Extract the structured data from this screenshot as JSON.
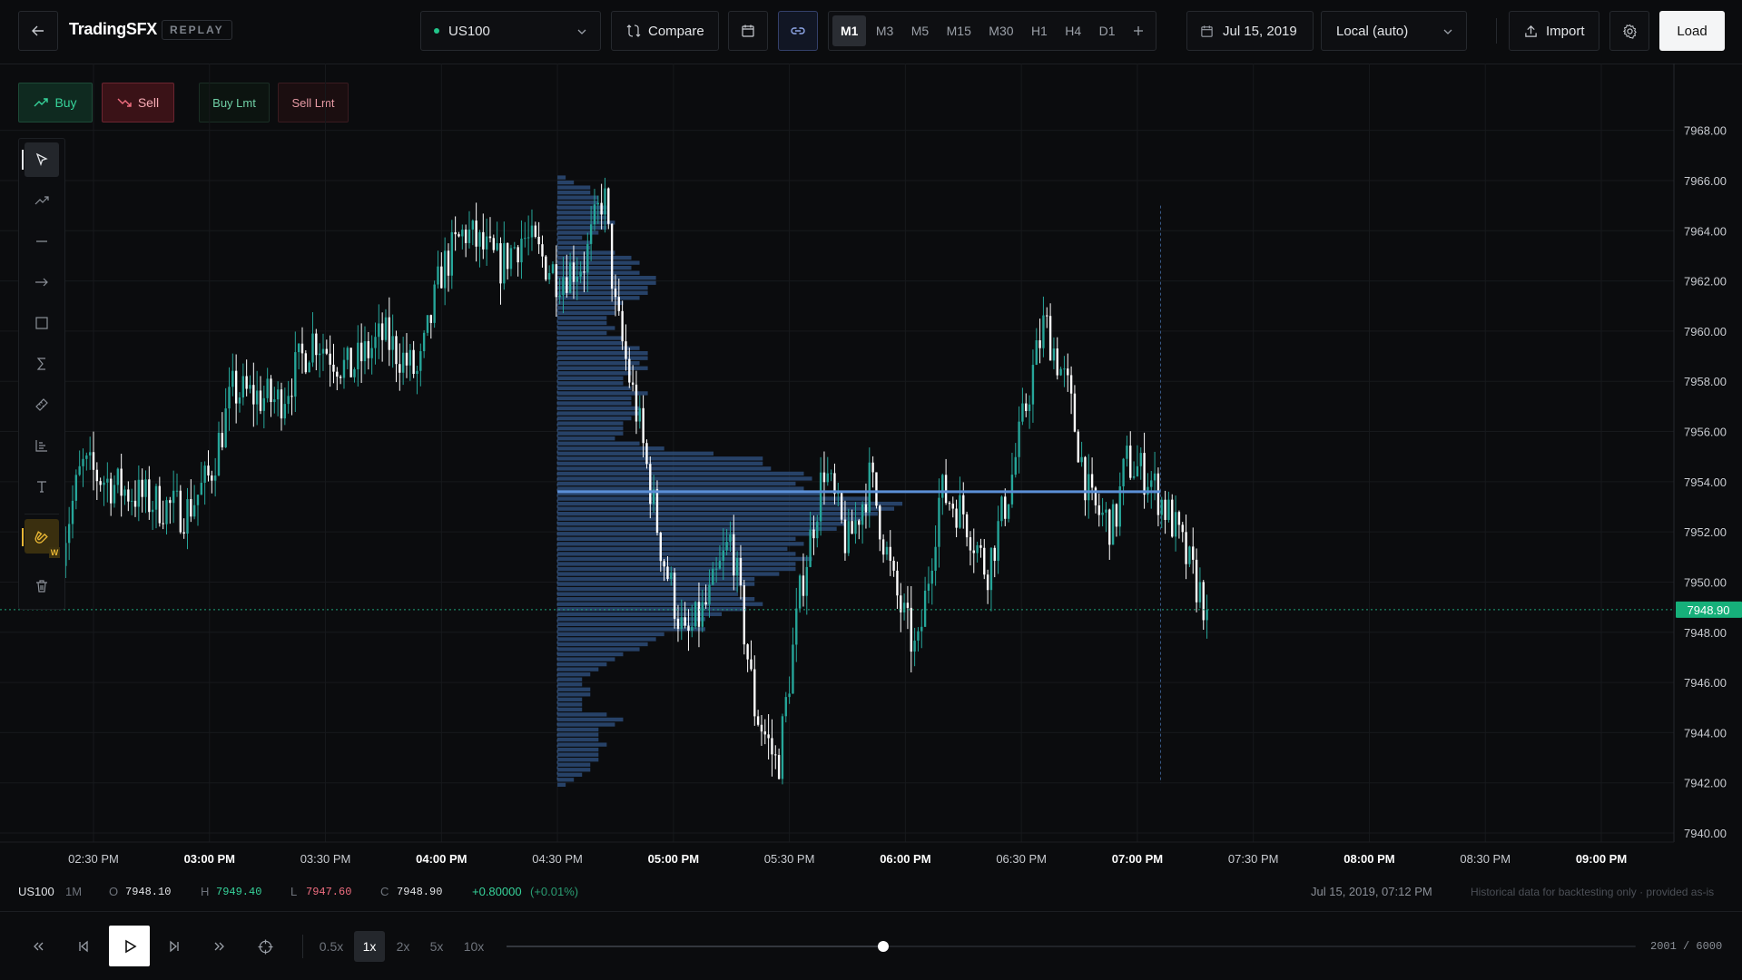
{
  "header": {
    "brand": "TradingSFX",
    "mode_badge": "REPLAY",
    "symbol": "US100",
    "compare_label": "Compare",
    "timeframes": [
      "M1",
      "M3",
      "M5",
      "M15",
      "M30",
      "H1",
      "H4",
      "D1"
    ],
    "active_timeframe": "M1",
    "date": "Jul 15, 2019",
    "timezone": "Local (auto)",
    "import_label": "Import",
    "load_label": "Load"
  },
  "orders": {
    "buy_label": "Buy",
    "sell_label": "Sell",
    "buy_limit_label": "Buy Lmt",
    "sell_limit_label": "Sell Lmt"
  },
  "tools": [
    "cursor-icon",
    "trendline-icon",
    "horizontal-line-icon",
    "ray-icon",
    "rectangle-icon",
    "sigma-icon",
    "ruler-icon",
    "volume-profile-icon",
    "text-icon",
    "magnet-icon",
    "trash-icon"
  ],
  "magnet_hotkey": "W",
  "chart_data": {
    "type": "candlestick",
    "symbol": "US100",
    "y_ticks": [
      "7968.00",
      "7966.00",
      "7964.00",
      "7962.00",
      "7960.00",
      "7958.00",
      "7956.00",
      "7954.00",
      "7952.00",
      "7950.00",
      "7948.00",
      "7946.00",
      "7944.00",
      "7942.00",
      "7940.00"
    ],
    "ylim": [
      7940,
      7968.8
    ],
    "x_ticks": [
      {
        "label": "02:30 PM",
        "bold": false
      },
      {
        "label": "03:00 PM",
        "bold": true
      },
      {
        "label": "03:30 PM",
        "bold": false
      },
      {
        "label": "04:00 PM",
        "bold": true
      },
      {
        "label": "04:30 PM",
        "bold": false
      },
      {
        "label": "05:00 PM",
        "bold": true
      },
      {
        "label": "05:30 PM",
        "bold": false
      },
      {
        "label": "06:00 PM",
        "bold": true
      },
      {
        "label": "06:30 PM",
        "bold": false
      },
      {
        "label": "07:00 PM",
        "bold": true
      },
      {
        "label": "07:30 PM",
        "bold": false
      },
      {
        "label": "08:00 PM",
        "bold": true
      },
      {
        "label": "08:30 PM",
        "bold": false
      },
      {
        "label": "09:00 PM",
        "bold": true
      }
    ],
    "last_price": "7948.90",
    "last_price_value": 7948.9,
    "volume_profile_poc": 7953.6,
    "bullish_color": "#26a69a",
    "bearish_color": "#ffffff",
    "profile_color": "#2d4c78",
    "poc_color": "#5b8fd6",
    "price_anchors": [
      [
        14.35,
        7951.0
      ],
      [
        14.45,
        7954.6
      ],
      [
        14.6,
        7953.8
      ],
      [
        14.75,
        7953.2
      ],
      [
        14.9,
        7952.8
      ],
      [
        15.0,
        7954.2
      ],
      [
        15.1,
        7957.6
      ],
      [
        15.3,
        7957.2
      ],
      [
        15.45,
        7959.8
      ],
      [
        15.6,
        7958.4
      ],
      [
        15.75,
        7959.8
      ],
      [
        15.9,
        7958.2
      ],
      [
        16.0,
        7962.4
      ],
      [
        16.1,
        7964.0
      ],
      [
        16.25,
        7962.6
      ],
      [
        16.35,
        7963.8
      ],
      [
        16.5,
        7962.2
      ],
      [
        16.62,
        7962.8
      ],
      [
        16.7,
        7965.6
      ],
      [
        16.75,
        7960.8
      ],
      [
        16.85,
        7956.4
      ],
      [
        16.95,
        7951.2
      ],
      [
        17.05,
        7947.6
      ],
      [
        17.15,
        7949.2
      ],
      [
        17.25,
        7951.8
      ],
      [
        17.35,
        7945.0
      ],
      [
        17.45,
        7942.6
      ],
      [
        17.55,
        7949.8
      ],
      [
        17.65,
        7954.6
      ],
      [
        17.75,
        7951.4
      ],
      [
        17.85,
        7954.2
      ],
      [
        17.95,
        7949.8
      ],
      [
        18.05,
        7947.0
      ],
      [
        18.15,
        7953.6
      ],
      [
        18.25,
        7952.8
      ],
      [
        18.35,
        7950.4
      ],
      [
        18.45,
        7953.8
      ],
      [
        18.55,
        7958.4
      ],
      [
        18.6,
        7960.4
      ],
      [
        18.7,
        7957.6
      ],
      [
        18.8,
        7953.0
      ],
      [
        18.9,
        7952.2
      ],
      [
        18.95,
        7954.8
      ],
      [
        19.05,
        7954.2
      ],
      [
        19.15,
        7952.4
      ],
      [
        19.25,
        7950.0
      ],
      [
        19.3,
        7948.9
      ]
    ],
    "candle_count": 330,
    "candle_seed": 7
  },
  "info": {
    "symbol": "US100",
    "interval": "1M",
    "o_label": "O",
    "o": "7948.10",
    "h_label": "H",
    "h": "7949.40",
    "l_label": "L",
    "l": "7947.60",
    "c_label": "C",
    "c": "7948.90",
    "change": "+0.80000",
    "change_pct": "(+0.01%)",
    "timestamp": "Jul 15, 2019, 07:12 PM",
    "disclaimer": "Historical data for backtesting only · provided as-is"
  },
  "playback": {
    "speeds": [
      "0.5x",
      "1x",
      "2x",
      "5x",
      "10x"
    ],
    "active_speed": "1x",
    "progress": 0.3335,
    "counter": "2001 / 6000"
  }
}
